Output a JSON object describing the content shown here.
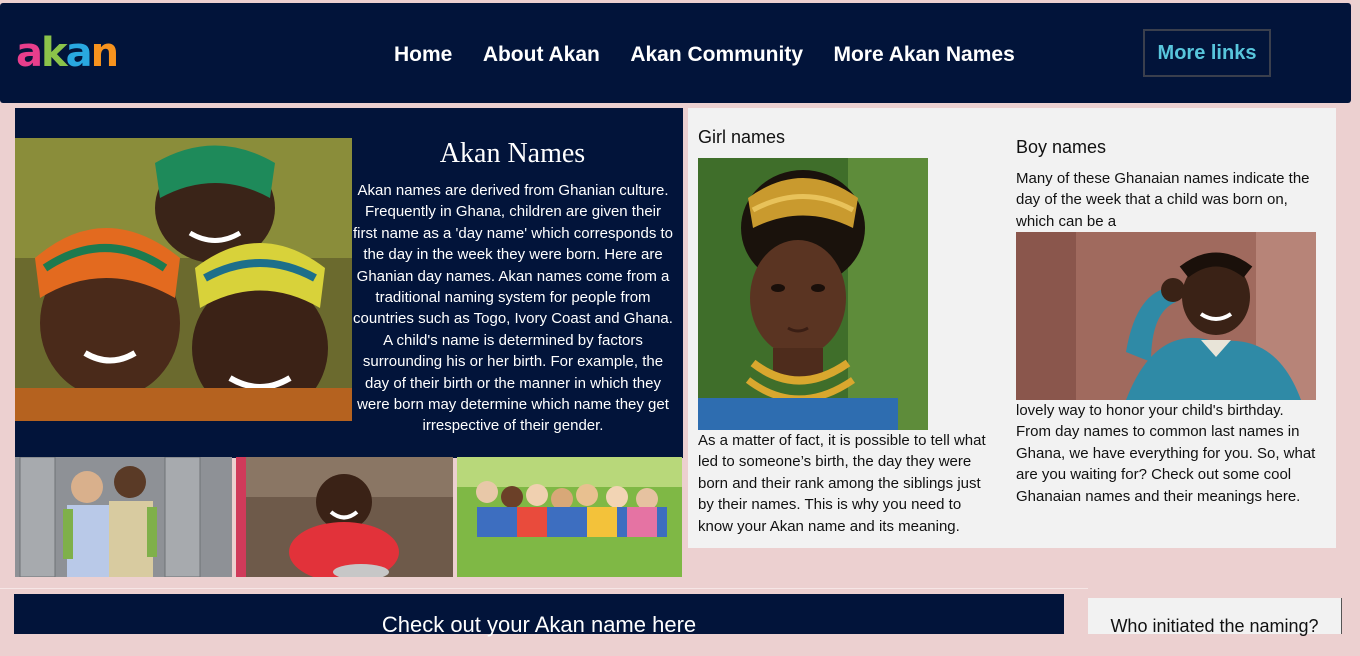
{
  "logo": {
    "letters": [
      "a",
      "k",
      "a",
      "n"
    ],
    "letter_colors": [
      "#e83e8c",
      "#8bc34a",
      "#29a8e0",
      "#f7931e"
    ]
  },
  "nav": {
    "links": [
      "Home",
      "About Akan",
      "Akan Community",
      "More Akan Names"
    ],
    "more_links_button": "More links"
  },
  "hero": {
    "title": "Akan Names",
    "text": "Akan names are derived from Ghanian culture. Frequently in Ghana, children are given their first name as a 'day name' which corresponds to the day in the week they were born. Here are Ghanian day names. Akan names come from a traditional naming system for people from countries such as Togo, Ivory Coast and Ghana. A child's name is determined by factors surrounding his or her birth. For example, the day of their birth or the manner in which they were born may determine which name they get irrespective of their gender."
  },
  "girl_section": {
    "heading": "Girl names",
    "text": "As a matter of fact, it is possible to tell what led to someone’s birth, the day they were born and their rank among the siblings just by their names. This is why you need to know your Akan name and its meaning."
  },
  "boy_section": {
    "heading": "Boy names",
    "text_before_image": "Many of these Ghanaian names indicate the day of the week that a child was born on, which can be a",
    "text_after_image": "lovely way to honor your child's birthday. From day names to common last names in Ghana, we have everything for you. So, what are you waiting for? Check out some cool Ghanaian names and their meanings here."
  },
  "check_banner": "Check out your Akan name here",
  "initiated_heading": "Who initiated the naming?",
  "colors": {
    "navy": "#02143a",
    "page_bg": "#ecd0d0",
    "panel_bg": "#f2f2f2",
    "accent": "#58c6dc"
  }
}
